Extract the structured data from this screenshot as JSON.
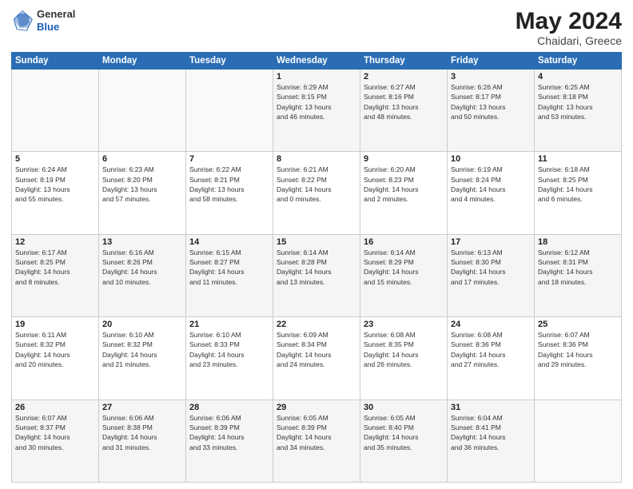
{
  "logo": {
    "general": "General",
    "blue": "Blue"
  },
  "header": {
    "title": "May 2024",
    "location": "Chaidari, Greece"
  },
  "days": [
    "Sunday",
    "Monday",
    "Tuesday",
    "Wednesday",
    "Thursday",
    "Friday",
    "Saturday"
  ],
  "weeks": [
    [
      {
        "day": "",
        "info": ""
      },
      {
        "day": "",
        "info": ""
      },
      {
        "day": "",
        "info": ""
      },
      {
        "day": "1",
        "info": "Sunrise: 6:29 AM\nSunset: 8:15 PM\nDaylight: 13 hours\nand 46 minutes."
      },
      {
        "day": "2",
        "info": "Sunrise: 6:27 AM\nSunset: 8:16 PM\nDaylight: 13 hours\nand 48 minutes."
      },
      {
        "day": "3",
        "info": "Sunrise: 6:26 AM\nSunset: 8:17 PM\nDaylight: 13 hours\nand 50 minutes."
      },
      {
        "day": "4",
        "info": "Sunrise: 6:25 AM\nSunset: 8:18 PM\nDaylight: 13 hours\nand 53 minutes."
      }
    ],
    [
      {
        "day": "5",
        "info": "Sunrise: 6:24 AM\nSunset: 8:19 PM\nDaylight: 13 hours\nand 55 minutes."
      },
      {
        "day": "6",
        "info": "Sunrise: 6:23 AM\nSunset: 8:20 PM\nDaylight: 13 hours\nand 57 minutes."
      },
      {
        "day": "7",
        "info": "Sunrise: 6:22 AM\nSunset: 8:21 PM\nDaylight: 13 hours\nand 58 minutes."
      },
      {
        "day": "8",
        "info": "Sunrise: 6:21 AM\nSunset: 8:22 PM\nDaylight: 14 hours\nand 0 minutes."
      },
      {
        "day": "9",
        "info": "Sunrise: 6:20 AM\nSunset: 8:23 PM\nDaylight: 14 hours\nand 2 minutes."
      },
      {
        "day": "10",
        "info": "Sunrise: 6:19 AM\nSunset: 8:24 PM\nDaylight: 14 hours\nand 4 minutes."
      },
      {
        "day": "11",
        "info": "Sunrise: 6:18 AM\nSunset: 8:25 PM\nDaylight: 14 hours\nand 6 minutes."
      }
    ],
    [
      {
        "day": "12",
        "info": "Sunrise: 6:17 AM\nSunset: 8:25 PM\nDaylight: 14 hours\nand 8 minutes."
      },
      {
        "day": "13",
        "info": "Sunrise: 6:16 AM\nSunset: 8:26 PM\nDaylight: 14 hours\nand 10 minutes."
      },
      {
        "day": "14",
        "info": "Sunrise: 6:15 AM\nSunset: 8:27 PM\nDaylight: 14 hours\nand 11 minutes."
      },
      {
        "day": "15",
        "info": "Sunrise: 6:14 AM\nSunset: 8:28 PM\nDaylight: 14 hours\nand 13 minutes."
      },
      {
        "day": "16",
        "info": "Sunrise: 6:14 AM\nSunset: 8:29 PM\nDaylight: 14 hours\nand 15 minutes."
      },
      {
        "day": "17",
        "info": "Sunrise: 6:13 AM\nSunset: 8:30 PM\nDaylight: 14 hours\nand 17 minutes."
      },
      {
        "day": "18",
        "info": "Sunrise: 6:12 AM\nSunset: 8:31 PM\nDaylight: 14 hours\nand 18 minutes."
      }
    ],
    [
      {
        "day": "19",
        "info": "Sunrise: 6:11 AM\nSunset: 8:32 PM\nDaylight: 14 hours\nand 20 minutes."
      },
      {
        "day": "20",
        "info": "Sunrise: 6:10 AM\nSunset: 8:32 PM\nDaylight: 14 hours\nand 21 minutes."
      },
      {
        "day": "21",
        "info": "Sunrise: 6:10 AM\nSunset: 8:33 PM\nDaylight: 14 hours\nand 23 minutes."
      },
      {
        "day": "22",
        "info": "Sunrise: 6:09 AM\nSunset: 8:34 PM\nDaylight: 14 hours\nand 24 minutes."
      },
      {
        "day": "23",
        "info": "Sunrise: 6:08 AM\nSunset: 8:35 PM\nDaylight: 14 hours\nand 26 minutes."
      },
      {
        "day": "24",
        "info": "Sunrise: 6:08 AM\nSunset: 8:36 PM\nDaylight: 14 hours\nand 27 minutes."
      },
      {
        "day": "25",
        "info": "Sunrise: 6:07 AM\nSunset: 8:36 PM\nDaylight: 14 hours\nand 29 minutes."
      }
    ],
    [
      {
        "day": "26",
        "info": "Sunrise: 6:07 AM\nSunset: 8:37 PM\nDaylight: 14 hours\nand 30 minutes."
      },
      {
        "day": "27",
        "info": "Sunrise: 6:06 AM\nSunset: 8:38 PM\nDaylight: 14 hours\nand 31 minutes."
      },
      {
        "day": "28",
        "info": "Sunrise: 6:06 AM\nSunset: 8:39 PM\nDaylight: 14 hours\nand 33 minutes."
      },
      {
        "day": "29",
        "info": "Sunrise: 6:05 AM\nSunset: 8:39 PM\nDaylight: 14 hours\nand 34 minutes."
      },
      {
        "day": "30",
        "info": "Sunrise: 6:05 AM\nSunset: 8:40 PM\nDaylight: 14 hours\nand 35 minutes."
      },
      {
        "day": "31",
        "info": "Sunrise: 6:04 AM\nSunset: 8:41 PM\nDaylight: 14 hours\nand 36 minutes."
      },
      {
        "day": "",
        "info": ""
      }
    ]
  ]
}
